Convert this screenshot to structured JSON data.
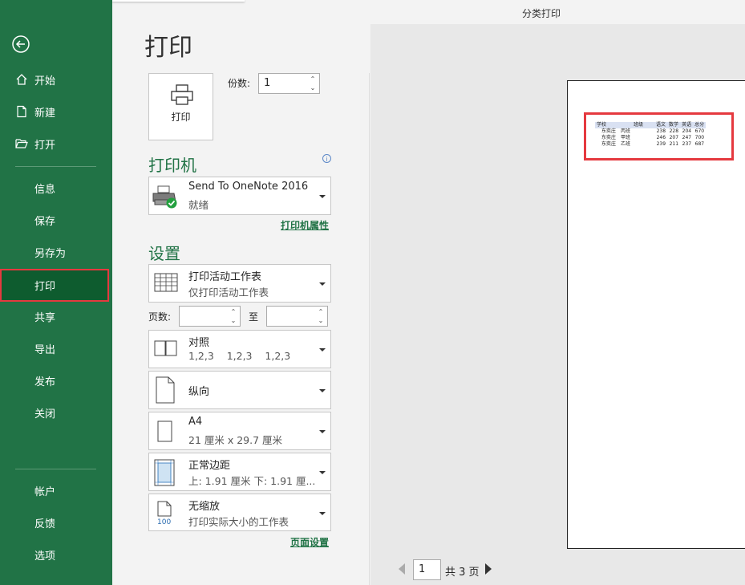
{
  "window_title": "分类打印",
  "sidebar": {
    "items_top": [
      {
        "label": "开始",
        "icon": "home-icon"
      },
      {
        "label": "新建",
        "icon": "new-doc-icon"
      },
      {
        "label": "打开",
        "icon": "folder-open-icon"
      }
    ],
    "items_mid": [
      {
        "label": "信息"
      },
      {
        "label": "保存"
      },
      {
        "label": "另存为"
      },
      {
        "label": "打印",
        "selected": true
      },
      {
        "label": "共享"
      },
      {
        "label": "导出"
      },
      {
        "label": "发布"
      },
      {
        "label": "关闭"
      }
    ],
    "items_bottom": [
      {
        "label": "帐户"
      },
      {
        "label": "反馈"
      },
      {
        "label": "选项"
      }
    ]
  },
  "page_title": "打印",
  "print_button": {
    "label": "打印",
    "icon": "printer-icon"
  },
  "copies": {
    "label": "份数:",
    "value": "1"
  },
  "printer_section": {
    "heading": "打印机",
    "printer": {
      "name": "Send To OneNote 2016",
      "status": "就绪",
      "icon": "printer-ready-icon"
    },
    "properties_link": "打印机属性"
  },
  "settings_section": {
    "heading": "设置",
    "what_to_print": {
      "title": "打印活动工作表",
      "subtitle": "仅打印活动工作表",
      "icon": "sheet-grid-icon"
    },
    "pages": {
      "label": "页数:",
      "to_label": "至",
      "from": "",
      "to": ""
    },
    "collation": {
      "title": "对照",
      "subtitle": "1,2,3    1,2,3    1,2,3",
      "icon": "collate-icon"
    },
    "orientation": {
      "title": "纵向",
      "icon": "portrait-page-icon"
    },
    "paper": {
      "title": "A4",
      "subtitle": "21 厘米 x 29.7 厘米",
      "icon": "paper-size-icon"
    },
    "margins": {
      "title": "正常边距",
      "subtitle": "上: 1.91 厘米 下: 1.91 厘...",
      "icon": "margins-icon"
    },
    "scaling": {
      "title": "无缩放",
      "subtitle": "打印实际大小的工作表",
      "icon": "no-scaling-icon",
      "icon_text": "100"
    },
    "page_setup_link": "页面设置"
  },
  "preview": {
    "table": {
      "headers": [
        "学校",
        "班级",
        "语文",
        "数学",
        "英语",
        "总分"
      ],
      "rows": [
        [
          "东奕庄",
          "丙班",
          "238",
          "228",
          "204",
          "670"
        ],
        [
          "东奕庄",
          "甲班",
          "246",
          "207",
          "247",
          "700"
        ],
        [
          "东奕庄",
          "乙班",
          "239",
          "211",
          "237",
          "687"
        ]
      ]
    },
    "highlight_color": "#e5393f"
  },
  "pager": {
    "current": "1",
    "total_text": "共 3 页"
  },
  "colors": {
    "brand_green": "#217346",
    "selected_green": "#0e5c2f",
    "highlight_red": "#e5393f"
  }
}
